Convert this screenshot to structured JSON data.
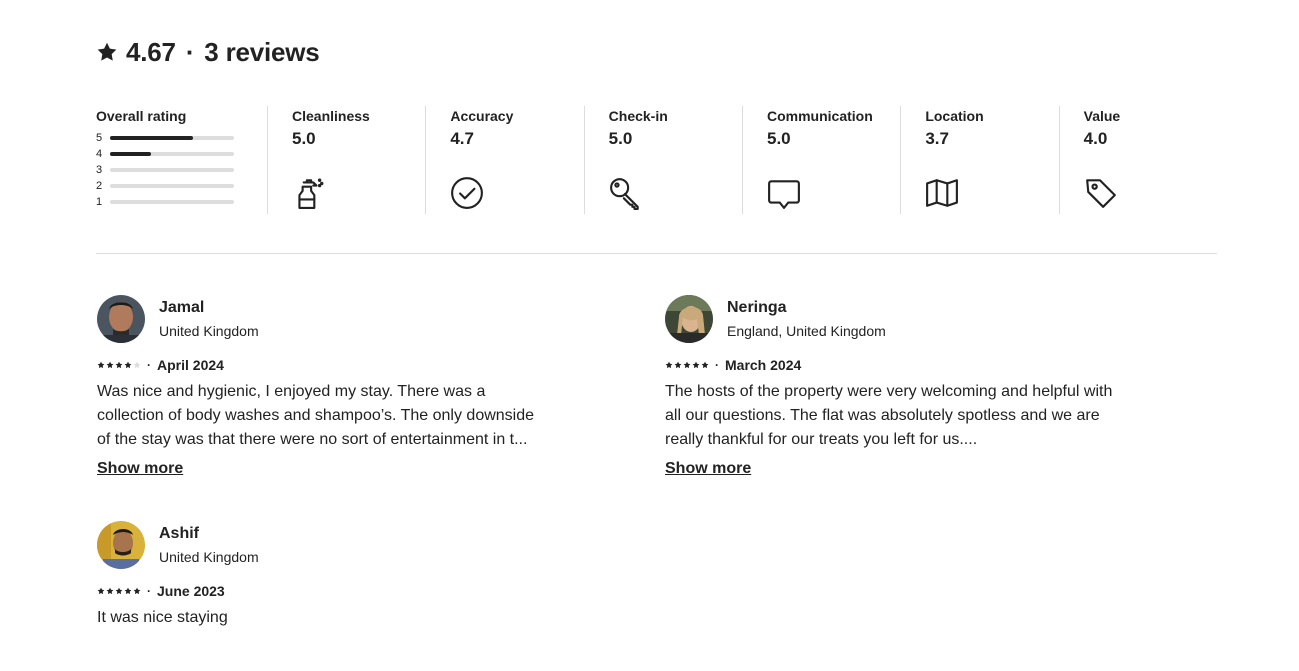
{
  "header": {
    "rating": "4.67",
    "separator": "·",
    "reviews": "3 reviews"
  },
  "overall": {
    "title": "Overall rating",
    "bars": [
      {
        "label": "5",
        "fraction": 0.67
      },
      {
        "label": "4",
        "fraction": 0.33
      },
      {
        "label": "3",
        "fraction": 0
      },
      {
        "label": "2",
        "fraction": 0
      },
      {
        "label": "1",
        "fraction": 0
      }
    ]
  },
  "categories": [
    {
      "name": "Cleanliness",
      "score": "5.0",
      "icon": "spray-bottle-icon"
    },
    {
      "name": "Accuracy",
      "score": "4.7",
      "icon": "check-circle-icon"
    },
    {
      "name": "Check-in",
      "score": "5.0",
      "icon": "key-icon"
    },
    {
      "name": "Communication",
      "score": "5.0",
      "icon": "chat-bubble-icon"
    },
    {
      "name": "Location",
      "score": "3.7",
      "icon": "map-icon"
    },
    {
      "name": "Value",
      "score": "4.0",
      "icon": "tag-icon"
    }
  ],
  "reviews": [
    {
      "name": "Jamal",
      "location": "United Kingdom",
      "stars": 4,
      "date": "April 2024",
      "text": "Was nice and hygienic, I enjoyed my stay. There was a collection of body washes and shampoo’s. The only downside of the stay was that there were no sort of entertainment in t...",
      "show_more": "Show more"
    },
    {
      "name": "Neringa",
      "location": "England, United Kingdom",
      "stars": 5,
      "date": "March 2024",
      "text": "The hosts of the property were very welcoming and helpful with all our questions. The flat was absolutely spotless and we are really thankful for our treats you left for us....",
      "show_more": "Show more"
    },
    {
      "name": "Ashif",
      "location": "United Kingdom",
      "stars": 5,
      "date": "June 2023",
      "text": "It was nice staying"
    }
  ],
  "colors": {
    "text": "#222222",
    "divider": "#dddddd",
    "star_empty": "#dddddd"
  }
}
